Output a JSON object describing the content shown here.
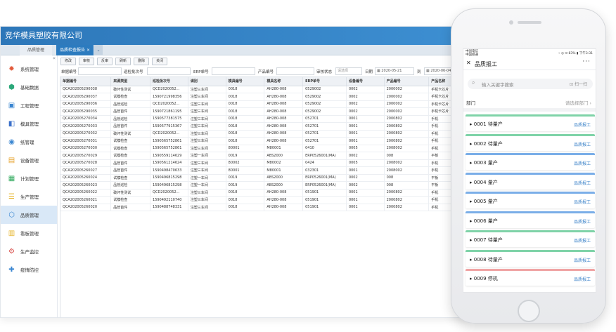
{
  "desktop": {
    "title": "竞华模具塑胶有限公司",
    "tabs": [
      {
        "label": "品质管理"
      },
      {
        "label": "品质检查报告",
        "close": "×"
      }
    ],
    "tab_more": "⌄",
    "collapse": "«",
    "sidebar": [
      {
        "label": "系统管理",
        "icon": "gear-icon",
        "glyph": "✹",
        "color": "#e25a3a"
      },
      {
        "label": "基础数据",
        "icon": "cube-icon",
        "glyph": "⬢",
        "color": "#2ca87a"
      },
      {
        "label": "工程管理",
        "icon": "engineering-icon",
        "glyph": "▣",
        "color": "#3a86d1"
      },
      {
        "label": "模具管理",
        "icon": "mold-icon",
        "glyph": "◧",
        "color": "#3a6fc9"
      },
      {
        "label": "纸管理",
        "icon": "paper-icon",
        "glyph": "◉",
        "color": "#3a86d1"
      },
      {
        "label": "设备管理",
        "icon": "equipment-icon",
        "glyph": "▤",
        "color": "#e6a22a"
      },
      {
        "label": "计划管理",
        "icon": "plan-icon",
        "glyph": "▦",
        "color": "#2ca85a"
      },
      {
        "label": "生产管理",
        "icon": "production-icon",
        "glyph": "☰",
        "color": "#e6b42a"
      },
      {
        "label": "品质管理",
        "icon": "quality-icon",
        "glyph": "⬡",
        "color": "#3a86d1",
        "active": true
      },
      {
        "label": "看板管理",
        "icon": "dashboard-icon",
        "glyph": "▥",
        "color": "#e6b42a"
      },
      {
        "label": "生产监控",
        "icon": "monitor-icon",
        "glyph": "⚙",
        "color": "#d9534f"
      },
      {
        "label": "疫情防控",
        "icon": "epidemic-icon",
        "glyph": "✚",
        "color": "#3a86d1"
      }
    ],
    "toolbar": [
      "修改",
      "审核",
      "反审",
      "刷新",
      "删除",
      "关闭"
    ],
    "filters": {
      "doc_no": "单据编号",
      "batch_no": "巡检批次号",
      "erp_no": "ERP单号",
      "product_no": "产品编号",
      "audit_status": "审核状态",
      "audit_placeholder": "请选择",
      "date": "日期",
      "date_from": "2020-05-21",
      "to": "到",
      "date_to": "2020-06-04"
    },
    "columns": [
      "单据编号",
      "来源类型",
      "巡检批次号",
      "课别",
      "模具编号",
      "模具名称",
      "ERP单号",
      "设备编号",
      "产品编号",
      "产品名称"
    ],
    "rows": [
      [
        "QCA202005290038",
        "破坏性测试",
        "QCD2020052...",
        "注塑三车间",
        "0018",
        "AH280-008",
        "0529002",
        "0002",
        "2000002",
        "手机卡芯片"
      ],
      [
        "QCA202005290037",
        "试模检查",
        "1590721998356",
        "注塑三车间",
        "0018",
        "AH280-008",
        "0529002",
        "0002",
        "2000002",
        "手机卡芯片"
      ],
      [
        "QCA202005290036",
        "品管巡检",
        "QCD2020052...",
        "注塑三车间",
        "0018",
        "AH280-008",
        "0529002",
        "0002",
        "2000002",
        "手机卡芯片"
      ],
      [
        "QCA202005290035",
        "品管首件",
        "1590721861195",
        "注塑三车间",
        "0018",
        "AH280-008",
        "0529002",
        "0002",
        "2000002",
        "手机卡芯片"
      ],
      [
        "QCA202005270034",
        "品管巡检",
        "1590577381575",
        "注塑三车间",
        "0018",
        "AH280-008",
        "052701",
        "0001",
        "2000802",
        "手机"
      ],
      [
        "QCA202005270033",
        "品管首件",
        "1590577915367",
        "注塑三车间",
        "0018",
        "AH280-008",
        "052701",
        "0001",
        "2000802",
        "手机"
      ],
      [
        "QCA202005270032",
        "破坏性测试",
        "QCD2020052...",
        "注塑三车间",
        "0018",
        "AH280-008",
        "052701",
        "0001",
        "2000802",
        "手机"
      ],
      [
        "QCA202005270031",
        "试模检查",
        "1590565752861",
        "注塑三车间",
        "0018",
        "AH280-008",
        "052701",
        "0001",
        "2000802",
        "手机"
      ],
      [
        "QCA202005270030",
        "试模检查",
        "1590565752861",
        "注塑三车间",
        "80001",
        "M80001",
        "0410",
        "0005",
        "2008002",
        "手机"
      ],
      [
        "QCA202005270029",
        "试模检查",
        "1590559114629",
        "注塑一车间",
        "0019",
        "ABS2000",
        "ERP0526001(MA)",
        "0002",
        "008",
        "平板"
      ],
      [
        "QCA202005270028",
        "品管首件",
        "1590561214624",
        "注塑三车间",
        "80002",
        "M80002",
        "0424",
        "0005",
        "2008002",
        "手机"
      ],
      [
        "QCA202005260027",
        "品管首件",
        "1590498470633",
        "注塑三车间",
        "80001",
        "M80001",
        "032301",
        "0001",
        "2008002",
        "手机"
      ],
      [
        "QCA202005260024",
        "试模检查",
        "1590496815298",
        "注塑一车间",
        "0019",
        "ABS2000",
        "ERP0526001(MA)",
        "0002",
        "008",
        "平板"
      ],
      [
        "QCA202005260023",
        "品管巡检",
        "1590496815298",
        "注塑一车间",
        "0019",
        "ABS2000",
        "ERP0526001(MA)",
        "0002",
        "008",
        "平板"
      ],
      [
        "QCA202005260022",
        "破坏性测试",
        "QCD2020052...",
        "注塑三车间",
        "0018",
        "AH280-008",
        "051901",
        "0001",
        "2000802",
        "手机"
      ],
      [
        "QCA202005260021",
        "试模检查",
        "1590492110740",
        "注塑三车间",
        "0018",
        "AH280-008",
        "051901",
        "0001",
        "2000802",
        "手机"
      ],
      [
        "QCA202005260020",
        "品管首件",
        "1590488748331",
        "注塑三车间",
        "0018",
        "AH280-008",
        "051901",
        "0001",
        "2000802",
        "手机"
      ]
    ]
  },
  "mobile": {
    "status_left_1": "中国电信",
    "status_left_2": "中国联通",
    "status_right": "⌁ ◎ ✉ 83% ▮ 下午3:31",
    "back": "✕",
    "title": "品质报工",
    "more": "···",
    "search_icon": "⌕",
    "search_placeholder": "输入关键字搜索",
    "scan": "扫一扫",
    "dept_label": "部门",
    "dept_value": "请选择部门 ›",
    "items": [
      {
        "label": "▸ 0001 待量产",
        "action": "品质报工",
        "color": "#7fd3a8"
      },
      {
        "label": "▸ 0002 待量产",
        "action": "品质报工",
        "color": "#7fd3a8"
      },
      {
        "label": "▸ 0003 量产",
        "action": "品质报工",
        "color": "#7aaee8"
      },
      {
        "label": "▸ 0004 量产",
        "action": "品质报工",
        "color": "#7aaee8"
      },
      {
        "label": "▸ 0005 量产",
        "action": "品质报工",
        "color": "#7aaee8"
      },
      {
        "label": "▸ 0006 量产",
        "action": "品质报工",
        "color": "#7aaee8"
      },
      {
        "label": "▸ 0007 待量产",
        "action": "品质报工",
        "color": "#7fd3a8"
      },
      {
        "label": "▸ 0008 待量产",
        "action": "品质报工",
        "color": "#7fd3a8"
      },
      {
        "label": "▸ 0009 停机",
        "action": "品质报工",
        "color": "#f0a4a4"
      }
    ]
  }
}
